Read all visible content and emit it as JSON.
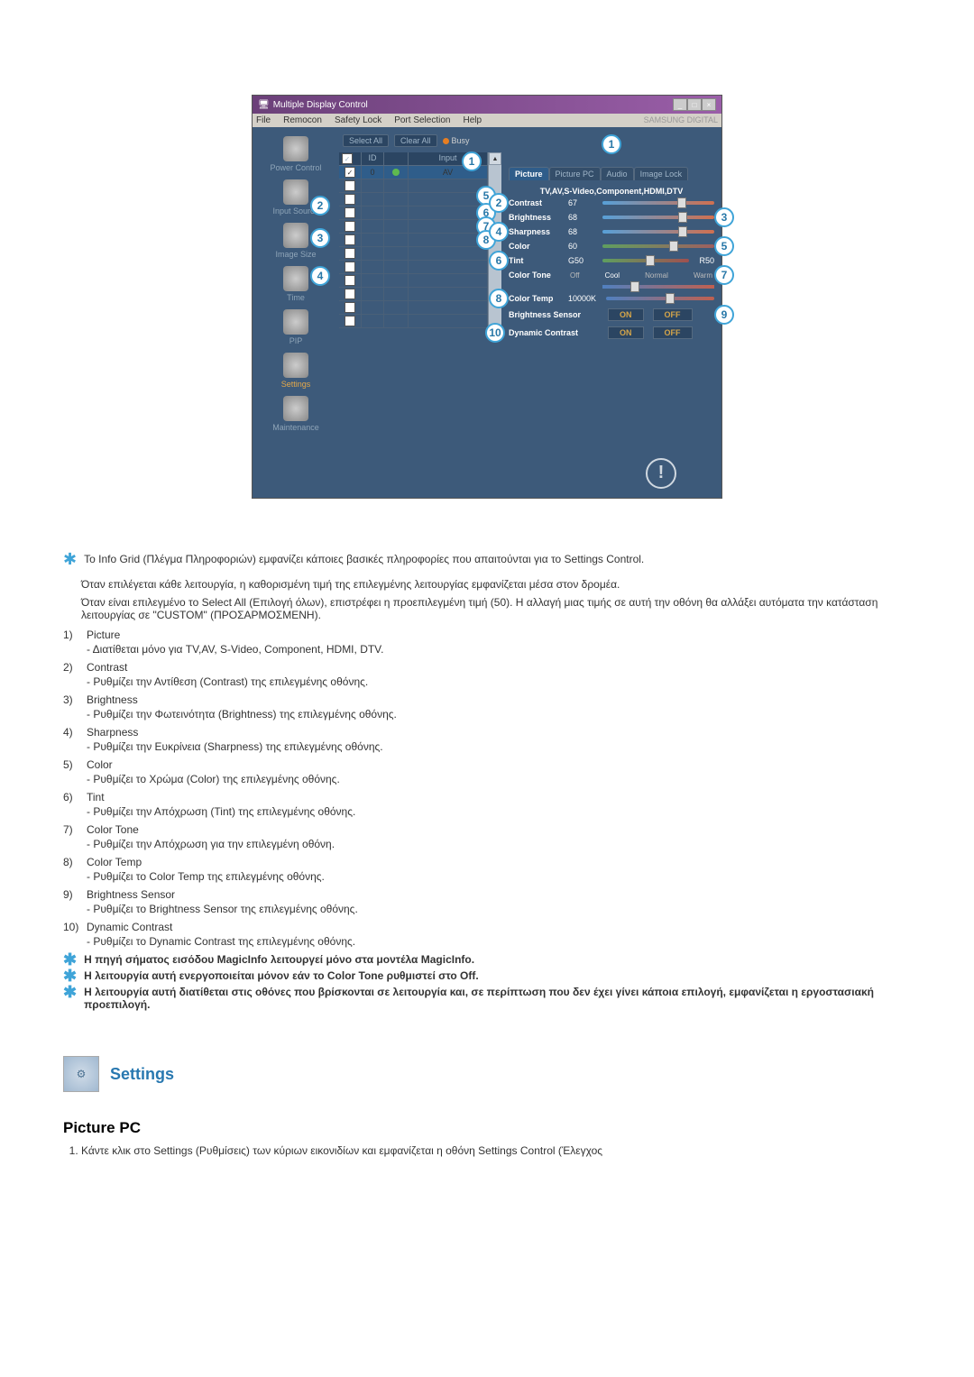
{
  "screenshot": {
    "title": "Multiple Display Control",
    "brand": "SAMSUNG DIGITAL",
    "menu": [
      "File",
      "Remocon",
      "Safety Lock",
      "Port Selection",
      "Help"
    ],
    "nav": [
      {
        "label": "Power Control"
      },
      {
        "label": "Input Source"
      },
      {
        "label": "Image Size"
      },
      {
        "label": "Time"
      },
      {
        "label": "PIP"
      },
      {
        "label": "Settings",
        "active": true
      },
      {
        "label": "Maintenance"
      }
    ],
    "btn_select_all": "Select All",
    "btn_clear_all": "Clear All",
    "busy": "Busy",
    "grid_header": {
      "col2": "ID",
      "col4_1": "Input",
      "col4_2": "AV"
    },
    "grid_rows": [
      {
        "checked": true,
        "id": "0",
        "status": "green"
      }
    ],
    "tabs": [
      "Picture",
      "Picture PC",
      "Audio",
      "Image Lock"
    ],
    "mode_line": "TV,AV,S-Video,Component,HDMI,DTV",
    "sliders": [
      {
        "label": "Contrast",
        "val": "67"
      },
      {
        "label": "Brightness",
        "val": "68"
      },
      {
        "label": "Sharpness",
        "val": "68"
      },
      {
        "label": "Color",
        "val": "60"
      },
      {
        "label": "Tint",
        "val": "G50",
        "val2": "R50"
      }
    ],
    "color_tone": {
      "label": "Color Tone",
      "options": [
        "Off",
        "Cool",
        "Normal",
        "Warm"
      ]
    },
    "color_temp": {
      "label": "Color Temp",
      "val": "10000K"
    },
    "brightness_sensor": {
      "label": "Brightness Sensor",
      "on": "ON",
      "off": "OFF"
    },
    "dynamic_contrast": {
      "label": "Dynamic Contrast",
      "on": "ON",
      "off": "OFF"
    }
  },
  "notes": {
    "info_grid": "Το Info Grid (Πλέγμα Πληροφοριών) εμφανίζει κάποιες βασικές πληροφορίες που απαιτούνται για το Settings Control.",
    "para1": "Όταν επιλέγεται κάθε λειτουργία, η καθορισμένη τιμή της επιλεγμένης λειτουργίας εμφανίζεται μέσα στον δρομέα.",
    "para2": "Όταν είναι επιλεγμένο το Select All (Επιλογή όλων), επιστρέφει η προεπιλεγμένη τιμή (50). Η αλλαγή μιας τιμής σε αυτή την οθόνη θα αλλάξει αυτόματα την κατάσταση λειτουργίας σε \"CUSTOM\" (ΠΡΟΣΑΡΜΟΣΜΕΝΗ)."
  },
  "items": [
    {
      "num": "1)",
      "title": "Picture",
      "desc": "- Διατίθεται μόνο για TV,AV, S-Video, Component, HDMI, DTV."
    },
    {
      "num": "2)",
      "title": "Contrast",
      "desc": "- Ρυθμίζει την Αντίθεση (Contrast) της επιλεγμένης οθόνης."
    },
    {
      "num": "3)",
      "title": "Brightness",
      "desc": "- Ρυθμίζει την Φωτεινότητα (Brightness) της επιλεγμένης οθόνης."
    },
    {
      "num": "4)",
      "title": "Sharpness",
      "desc": "- Ρυθμίζει την Ευκρίνεια (Sharpness) της επιλεγμένης οθόνης."
    },
    {
      "num": "5)",
      "title": "Color",
      "desc": "- Ρυθμίζει το Χρώμα (Color) της επιλεγμένης οθόνης."
    },
    {
      "num": "6)",
      "title": "Tint",
      "desc": "- Ρυθμίζει την Απόχρωση (Tint) της επιλεγμένης οθόνης."
    },
    {
      "num": "7)",
      "title": "Color Tone",
      "desc": "- Ρυθμίζει την Απόχρωση για την επιλεγμένη οθόνη."
    },
    {
      "num": "8)",
      "title": "Color Temp",
      "desc": "- Ρυθμίζει το Color Temp της επιλεγμένης οθόνης."
    },
    {
      "num": "9)",
      "title": "Brightness Sensor",
      "desc": "- Ρυθμίζει το Brightness Sensor της επιλεγμένης οθόνης."
    },
    {
      "num": "10)",
      "title": "Dynamic Contrast",
      "desc": "- Ρυθμίζει το Dynamic Contrast της επιλεγμένης οθόνης."
    }
  ],
  "footnotes": [
    "Η πηγή σήματος εισόδου MagicInfo λειτουργεί μόνο στα μοντέλα MagicInfo.",
    "Η λειτουργία αυτή ενεργοποιείται μόνον εάν το Color Tone ρυθμιστεί στο Off.",
    "Η λειτουργία αυτή διατίθεται στις οθόνες που βρίσκονται σε λειτουργία και, σε περίπτωση που δεν έχει γίνει κάποια επιλογή, εμφανίζεται η εργοστασιακή προεπιλογή."
  ],
  "section_title": "Settings",
  "sub_title": "Picture PC",
  "step1": "Κάντε κλικ στο Settings (Ρυθμίσεις) των κύριων εικονιδίων και εμφανίζεται η οθόνη Settings Control (Έλεγχος"
}
